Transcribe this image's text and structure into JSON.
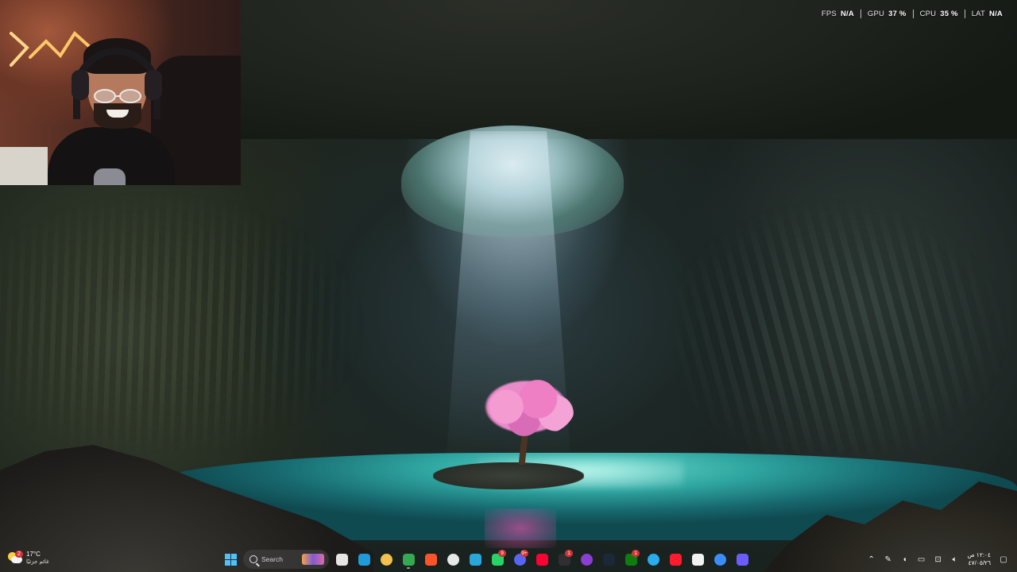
{
  "overlay": {
    "fps": {
      "label": "FPS",
      "value": "N/A"
    },
    "gpu": {
      "label": "GPU",
      "value": "37 %"
    },
    "cpu": {
      "label": "CPU",
      "value": "35 %"
    },
    "lat": {
      "label": "LAT",
      "value": "N/A"
    }
  },
  "weather": {
    "temperature": "17°C",
    "condition": "غائم جزئيًا",
    "badge": "2",
    "icon": "partly-cloudy-icon"
  },
  "taskbar": {
    "search_placeholder": "Search",
    "apps": [
      {
        "name": "start-button",
        "icon": "windows-logo-icon"
      },
      {
        "name": "task-view",
        "icon": "task-view-icon",
        "color": "#e6e6e6"
      },
      {
        "name": "edge",
        "icon": "edge-icon",
        "color": "#1f9cd8"
      },
      {
        "name": "file-explorer",
        "icon": "folder-icon",
        "color": "#f2c14e"
      },
      {
        "name": "chrome",
        "icon": "chrome-icon",
        "color": "#34a853",
        "running": true
      },
      {
        "name": "brave",
        "icon": "brave-icon",
        "color": "#fb542b"
      },
      {
        "name": "microsoft-store",
        "icon": "store-icon",
        "color": "#e8e8e8"
      },
      {
        "name": "photos",
        "icon": "photos-icon",
        "color": "#2aa7d8"
      },
      {
        "name": "whatsapp",
        "icon": "whatsapp-icon",
        "color": "#25d366",
        "badge": "9"
      },
      {
        "name": "discord",
        "icon": "discord-icon",
        "color": "#5865f2",
        "badge": "9+"
      },
      {
        "name": "youtube",
        "icon": "youtube-icon",
        "color": "#ff0033"
      },
      {
        "name": "obs",
        "icon": "obs-icon",
        "color": "#302e31",
        "badge": "1"
      },
      {
        "name": "notes",
        "icon": "purple-app-icon",
        "color": "#8b3fd1"
      },
      {
        "name": "steam",
        "icon": "steam-icon",
        "color": "#1b2838"
      },
      {
        "name": "xbox",
        "icon": "xbox-icon",
        "color": "#107c10",
        "badge": "1"
      },
      {
        "name": "telegram",
        "icon": "telegram-icon",
        "color": "#2aabee"
      },
      {
        "name": "opera",
        "icon": "opera-icon",
        "color": "#ff1b2d"
      },
      {
        "name": "capcut",
        "icon": "capcut-icon",
        "color": "#f2f2f2"
      },
      {
        "name": "pen-app",
        "icon": "pen-icon",
        "color": "#3a8dff"
      },
      {
        "name": "copilot",
        "icon": "copilot-icon",
        "color": "#6a5cff"
      }
    ]
  },
  "tray": {
    "time": "١٢:٠٤ ص",
    "date": "٤٧/٠٥/٢٦"
  }
}
